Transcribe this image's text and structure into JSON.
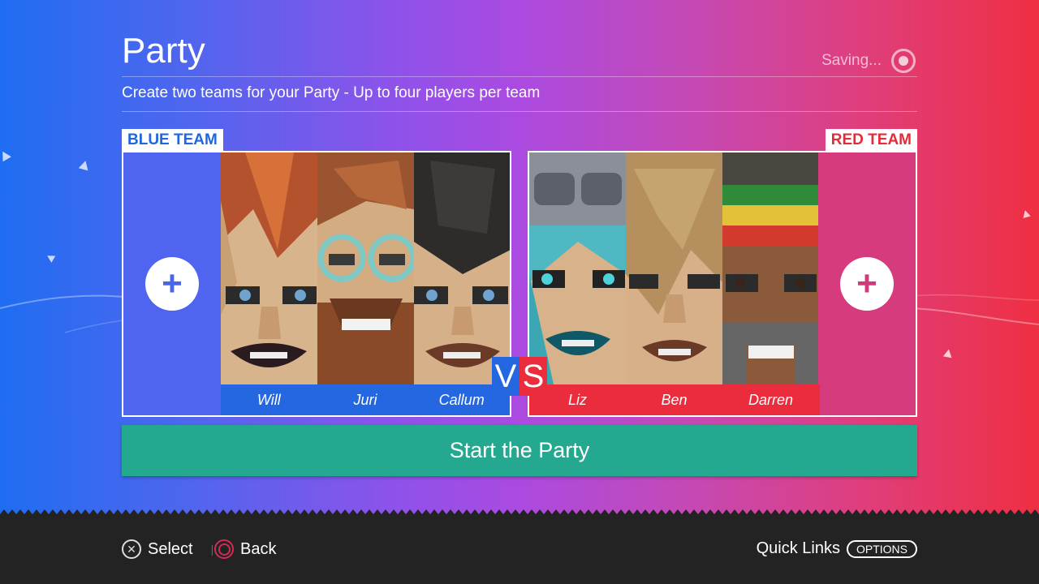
{
  "header": {
    "title": "Party",
    "saving_label": "Saving...",
    "subtitle": "Create two teams for your Party - Up to four players per team"
  },
  "teams": {
    "blue": {
      "label": "BLUE TEAM",
      "players": [
        "Will",
        "Juri",
        "Callum"
      ]
    },
    "red": {
      "label": "RED TEAM",
      "players": [
        "Liz",
        "Ben",
        "Darren"
      ]
    }
  },
  "vs": {
    "v": "V",
    "s": "S"
  },
  "start_button": "Start the Party",
  "footer": {
    "select_label": "Select",
    "back_label": "Back",
    "quick_links_label": "Quick Links",
    "options_label": "OPTIONS"
  },
  "icons": {
    "add": "plus-icon",
    "saving": "spinner-icon",
    "select": "cross-button-icon",
    "back": "circle-button-icon"
  },
  "colors": {
    "blue_team": "#2467e0",
    "red_team": "#ea2c3d",
    "start_button": "#25a890",
    "footer": "#232323"
  }
}
